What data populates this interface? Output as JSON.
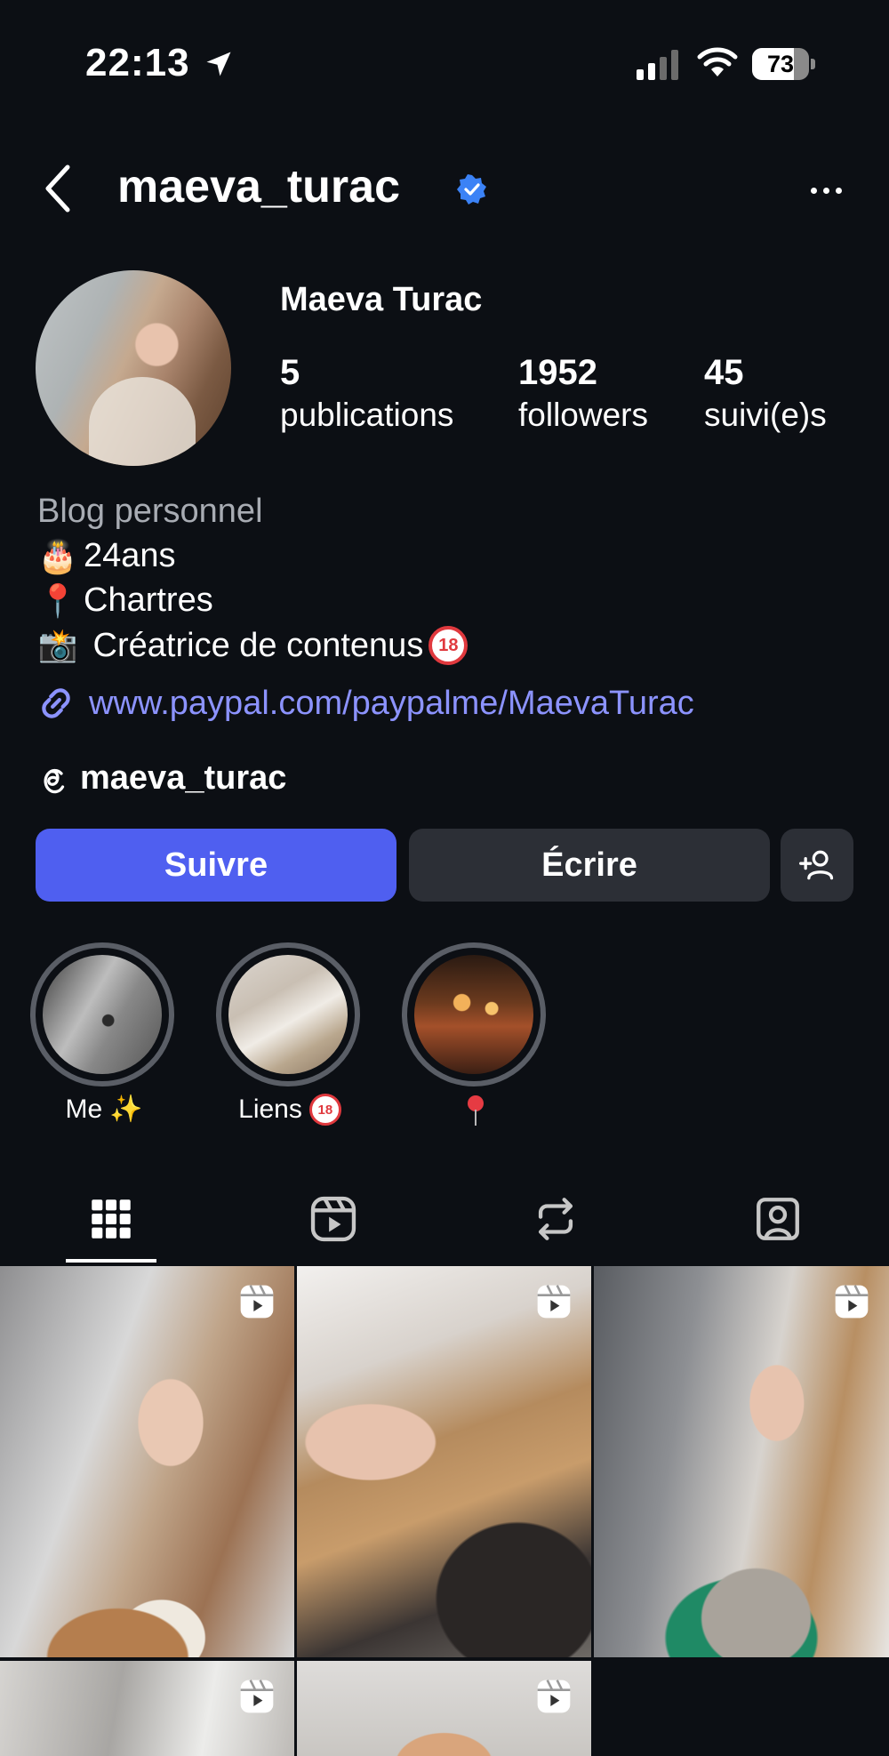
{
  "status_bar": {
    "time": "22:13",
    "battery_level": 73,
    "battery_text": "73"
  },
  "header": {
    "username": "maeva_turac",
    "verified": true,
    "back_icon": "chevron-left-icon",
    "more_icon": "more-horizontal-icon"
  },
  "profile": {
    "display_name": "Maeva Turac",
    "stats": [
      {
        "value": "5",
        "label": "publications"
      },
      {
        "value": "1952",
        "label": "followers"
      },
      {
        "value": "45",
        "label": "suivi(e)s"
      }
    ],
    "category": "Blog personnel",
    "bio": {
      "line1_emoji": "🎂",
      "line1_text": "24ans",
      "line2_emoji": "📍",
      "line2_text": "Chartres",
      "line3_emoji": "📸",
      "line3_text": " Créatrice de contenus",
      "line3_badge": "18"
    },
    "link": "www.paypal.com/paypalme/MaevaTurac",
    "threads_handle": "maeva_turac"
  },
  "actions": {
    "follow_label": "Suivre",
    "message_label": "Écrire",
    "suggest_icon": "add-person-icon"
  },
  "highlights": [
    {
      "label": "Me",
      "emoji": "✨"
    },
    {
      "label": "Liens",
      "badge": "18"
    },
    {
      "label": "",
      "icon": "pin-icon"
    }
  ],
  "tabs": [
    {
      "name": "grid",
      "icon": "grid-icon",
      "active": true
    },
    {
      "name": "reels",
      "icon": "reels-icon",
      "active": false
    },
    {
      "name": "reposts",
      "icon": "repost-icon",
      "active": false
    },
    {
      "name": "tagged",
      "icon": "tagged-icon",
      "active": false
    }
  ],
  "posts": [
    {
      "type": "reel"
    },
    {
      "type": "reel"
    },
    {
      "type": "reel"
    },
    {
      "type": "reel"
    },
    {
      "type": "reel"
    }
  ],
  "colors": {
    "background": "#0c0f14",
    "accent": "#4f5ff0",
    "link": "#8c93ff",
    "verified": "#3b82f6"
  }
}
